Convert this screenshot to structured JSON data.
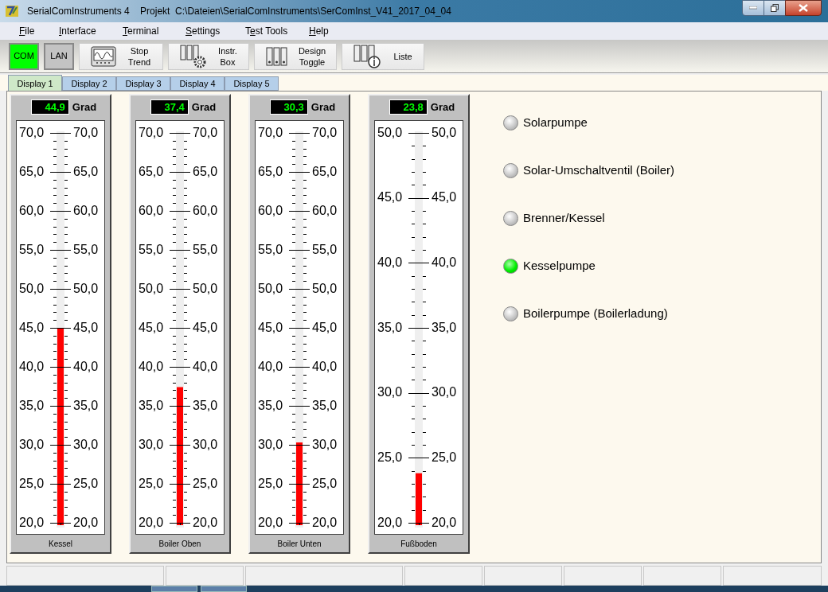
{
  "window": {
    "title": "SerialComInstruments 4    Projekt  C:\\Dateien\\SerialComInstruments\\SerComInst_V41_2017_04_04"
  },
  "menu": [
    {
      "key": "F",
      "tail": "ile"
    },
    {
      "key": "I",
      "tail": "nterface"
    },
    {
      "key": "T",
      "tail": "erminal"
    },
    {
      "key": "S",
      "tail": "ettings"
    },
    {
      "lead": "T",
      "key": "e",
      "tail": "st Tools"
    },
    {
      "key": "H",
      "tail": "elp"
    }
  ],
  "toolbar": [
    {
      "kind": "toggle",
      "lines": [
        "COM"
      ],
      "on": true
    },
    {
      "kind": "toggle",
      "lines": [
        "LAN"
      ],
      "on": false
    },
    {
      "kind": "trend",
      "lines": [
        "Stop",
        "Trend"
      ]
    },
    {
      "kind": "instr",
      "lines": [
        "Instr.",
        "Box"
      ]
    },
    {
      "kind": "design",
      "lines": [
        "Design",
        "Toggle"
      ]
    },
    {
      "kind": "liste",
      "lines": [
        "Liste"
      ]
    }
  ],
  "tabs": [
    {
      "label": "Display 1",
      "selected": true
    },
    {
      "label": "Display 2",
      "selected": false
    },
    {
      "label": "Display 3",
      "selected": false
    },
    {
      "label": "Display 4",
      "selected": false
    },
    {
      "label": "Display 5",
      "selected": false
    }
  ],
  "thermometers": [
    {
      "reading": "44,9",
      "unit": "Grad",
      "level": 0.498,
      "left_labels": [
        "70,0",
        "65,0",
        "60,0",
        "55,0",
        "50,0",
        "45,0",
        "40,0",
        "35,0",
        "30,0",
        "25,0",
        "20,0"
      ],
      "right_labels": [
        "70,0",
        "65,0",
        "60,0",
        "55,0",
        "50,0",
        "45,0",
        "40,0",
        "35,0",
        "30,0",
        "25,0",
        "20,0"
      ],
      "name": "Kessel"
    },
    {
      "reading": "37,4",
      "unit": "Grad",
      "level": 0.348,
      "left_labels": [
        "70,0",
        "65,0",
        "60,0",
        "55,0",
        "50,0",
        "45,0",
        "40,0",
        "35,0",
        "30,0",
        "25,0",
        "20,0"
      ],
      "right_labels": [
        "70,0",
        "65,0",
        "60,0",
        "55,0",
        "50,0",
        "45,0",
        "40,0",
        "35,0",
        "30,0",
        "25,0",
        "20,0"
      ],
      "name": "Boiler Oben"
    },
    {
      "reading": "30,3",
      "unit": "Grad",
      "level": 0.206,
      "left_labels": [
        "70,0",
        "65,0",
        "60,0",
        "55,0",
        "50,0",
        "45,0",
        "40,0",
        "35,0",
        "30,0",
        "25,0",
        "20,0"
      ],
      "right_labels": [
        "70,0",
        "65,0",
        "60,0",
        "55,0",
        "50,0",
        "45,0",
        "40,0",
        "35,0",
        "30,0",
        "25,0",
        "20,0"
      ],
      "name": "Boiler Unten"
    },
    {
      "reading": "23,8",
      "unit": "Grad",
      "level": 0.127,
      "left_labels": [
        "50,0",
        "45,0",
        "40,0",
        "35,0",
        "30,0",
        "25,0",
        "20,0"
      ],
      "right_labels": [
        "50,0",
        "45,0",
        "40,0",
        "35,0",
        "30,0",
        "25,0",
        "20,0"
      ],
      "name": "Fußboden"
    }
  ],
  "indicators": [
    {
      "label": "Solarpumpe",
      "on": false
    },
    {
      "label": "Solar-Umschaltventil (Boiler)",
      "on": false
    },
    {
      "label": "Brenner/Kessel",
      "on": false
    },
    {
      "label": "Kesselpumpe",
      "on": true
    },
    {
      "label": "Boilerpumpe (Boilerladung)",
      "on": false
    }
  ]
}
